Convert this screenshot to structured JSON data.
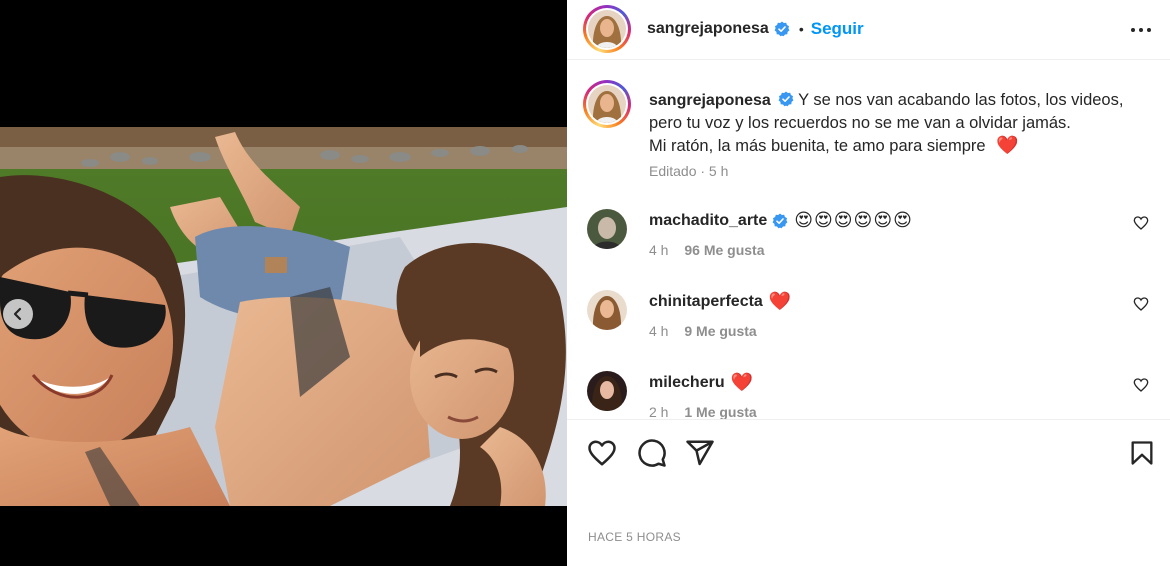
{
  "post": {
    "author": "sangrejaponesa",
    "follow_label": "Seguir",
    "separator": "•",
    "caption_line1": "Y se nos van acabando las fotos, los videos,",
    "caption_line2": "pero tu voz y los recuerdos no se me van a olvidar jamás.",
    "caption_line3": "Mi ratón, la más buenita, te amo para siempre",
    "caption_emoji": "❤️",
    "caption_meta": "Editado · 5 h",
    "timestamp": "HACE 5 HORAS"
  },
  "comments": [
    {
      "user": "machadito_arte",
      "text": "😍😍😍😍😍😍",
      "verified": true,
      "time": "4 h",
      "likes": "96 Me gusta"
    },
    {
      "user": "chinitaperfecta",
      "text": "❤️",
      "verified": false,
      "time": "4 h",
      "likes": "9 Me gusta"
    },
    {
      "user": "milecheru",
      "text": "❤️",
      "verified": false,
      "time": "2 h",
      "likes": "1 Me gusta"
    }
  ],
  "colors": {
    "accent": "#0095f6",
    "verified": "#3897f0",
    "heart": "#e0245e",
    "muted": "#8e8e8e"
  },
  "icons": [
    "verified-badge-icon",
    "more-options-icon",
    "like-heart-icon",
    "comment-icon",
    "share-icon",
    "save-bookmark-icon",
    "chevron-left-icon"
  ]
}
